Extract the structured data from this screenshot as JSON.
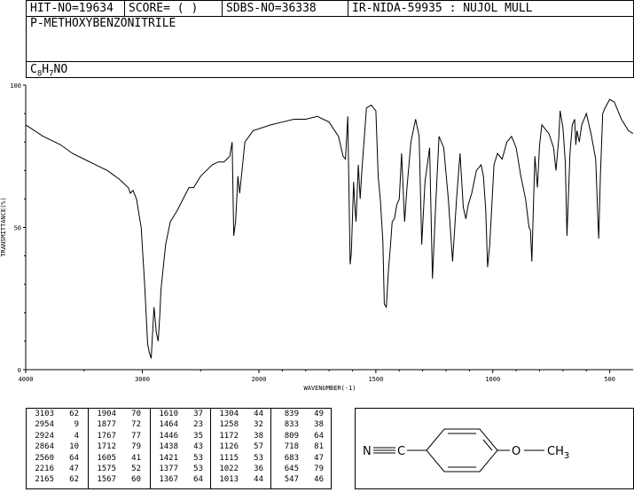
{
  "header": {
    "hit_no": "HIT-NO=19634",
    "score": "SCORE=  (   )",
    "sdbs_no": "SDBS-NO=36338",
    "ir_info": "IR-NIDA-59935 : NUJOL MULL"
  },
  "compound": {
    "name": "P-METHOXYBENZONITRILE",
    "formula_parts": [
      "C",
      "8",
      "H",
      "7",
      "NO"
    ]
  },
  "chart_data": {
    "type": "line",
    "xlabel": "WAVENUMBER(-1)",
    "ylabel": "TRANSMITTANCE(%)",
    "xlim": [
      4000,
      400
    ],
    "ylim": [
      0,
      100
    ],
    "x_ticks": [
      "4000",
      "3000",
      "2000",
      "1500",
      "1000",
      "500"
    ],
    "y_ticks": [
      "0",
      "50",
      "100"
    ],
    "grid": false,
    "line_color": "#000000",
    "series": [
      {
        "x": [
          4000,
          3850,
          3700,
          3600,
          3500,
          3400,
          3300,
          3200,
          3120,
          3103,
          3080,
          3050,
          3010,
          2980,
          2954,
          2940,
          2924,
          2900,
          2880,
          2864,
          2850,
          2840,
          2800,
          2760,
          2700,
          2650,
          2600,
          2560,
          2500,
          2450,
          2400,
          2350,
          2300,
          2250,
          2230,
          2216,
          2200,
          2180,
          2165,
          2120,
          2050,
          1950,
          1900,
          1850,
          1800,
          1750,
          1700,
          1660,
          1640,
          1630,
          1620,
          1610,
          1605,
          1595,
          1590,
          1585,
          1575,
          1567,
          1560,
          1540,
          1520,
          1500,
          1490,
          1480,
          1470,
          1464,
          1455,
          1446,
          1438,
          1430,
          1421,
          1410,
          1400,
          1390,
          1377,
          1367,
          1350,
          1330,
          1315,
          1304,
          1290,
          1270,
          1258,
          1245,
          1230,
          1210,
          1190,
          1172,
          1155,
          1140,
          1126,
          1115,
          1105,
          1090,
          1070,
          1050,
          1040,
          1030,
          1022,
          1013,
          1005,
          995,
          980,
          960,
          940,
          920,
          900,
          880,
          860,
          845,
          839,
          833,
          820,
          809,
          800,
          790,
          760,
          740,
          730,
          718,
          712,
          700,
          690,
          683,
          670,
          660,
          650,
          645,
          640,
          630,
          620,
          600,
          580,
          560,
          550,
          547,
          540,
          530,
          520,
          500,
          480,
          450,
          420,
          400
        ],
        "y": [
          86,
          82,
          79,
          76,
          74,
          72,
          70,
          67,
          64,
          62,
          63,
          60,
          50,
          30,
          9,
          6,
          4,
          22,
          13,
          10,
          19,
          28,
          44,
          52,
          56,
          60,
          64,
          64,
          68,
          70,
          72,
          73,
          73,
          75,
          80,
          47,
          52,
          68,
          62,
          80,
          84,
          86,
          87,
          88,
          88,
          89,
          87,
          82,
          75,
          74,
          89,
          37,
          41,
          66,
          58,
          52,
          72,
          60,
          70,
          92,
          93,
          91,
          68,
          59,
          45,
          23,
          22,
          35,
          43,
          52,
          53,
          58,
          60,
          76,
          52,
          64,
          80,
          88,
          82,
          44,
          66,
          78,
          32,
          56,
          82,
          78,
          60,
          38,
          60,
          76,
          57,
          53,
          58,
          62,
          70,
          72,
          68,
          56,
          36,
          44,
          56,
          72,
          76,
          74,
          80,
          82,
          78,
          68,
          60,
          50,
          49,
          38,
          75,
          64,
          79,
          86,
          83,
          78,
          70,
          81,
          91,
          85,
          73,
          47,
          76,
          86,
          88,
          79,
          84,
          80,
          86,
          90,
          83,
          74,
          52,
          46,
          68,
          90,
          92,
          95,
          94,
          88,
          84,
          83
        ]
      }
    ]
  },
  "peak_table": {
    "columns": [
      [
        [
          "3103",
          "62"
        ],
        [
          "2954",
          "9"
        ],
        [
          "2924",
          "4"
        ],
        [
          "2864",
          "10"
        ],
        [
          "2560",
          "64"
        ],
        [
          "2216",
          "47"
        ],
        [
          "2165",
          "62"
        ]
      ],
      [
        [
          "1904",
          "70"
        ],
        [
          "1877",
          "72"
        ],
        [
          "1767",
          "77"
        ],
        [
          "1712",
          "79"
        ],
        [
          "1605",
          "41"
        ],
        [
          "1575",
          "52"
        ],
        [
          "1567",
          "60"
        ]
      ],
      [
        [
          "1610",
          "37"
        ],
        [
          "1464",
          "23"
        ],
        [
          "1446",
          "35"
        ],
        [
          "1438",
          "43"
        ],
        [
          "1421",
          "53"
        ],
        [
          "1377",
          "53"
        ],
        [
          "1367",
          "64"
        ]
      ],
      [
        [
          "1304",
          "44"
        ],
        [
          "1258",
          "32"
        ],
        [
          "1172",
          "38"
        ],
        [
          "1126",
          "57"
        ],
        [
          "1115",
          "53"
        ],
        [
          "1022",
          "36"
        ],
        [
          "1013",
          "44"
        ]
      ],
      [
        [
          "839",
          "49"
        ],
        [
          "833",
          "38"
        ],
        [
          "809",
          "64"
        ],
        [
          "718",
          "81"
        ],
        [
          "683",
          "47"
        ],
        [
          "645",
          "79"
        ],
        [
          "547",
          "46"
        ]
      ]
    ]
  },
  "structure": {
    "nitrile_n": "N",
    "nitrile_c": "C",
    "ether_o": "O",
    "methyl_c": "CH",
    "methyl_sub": "3"
  }
}
